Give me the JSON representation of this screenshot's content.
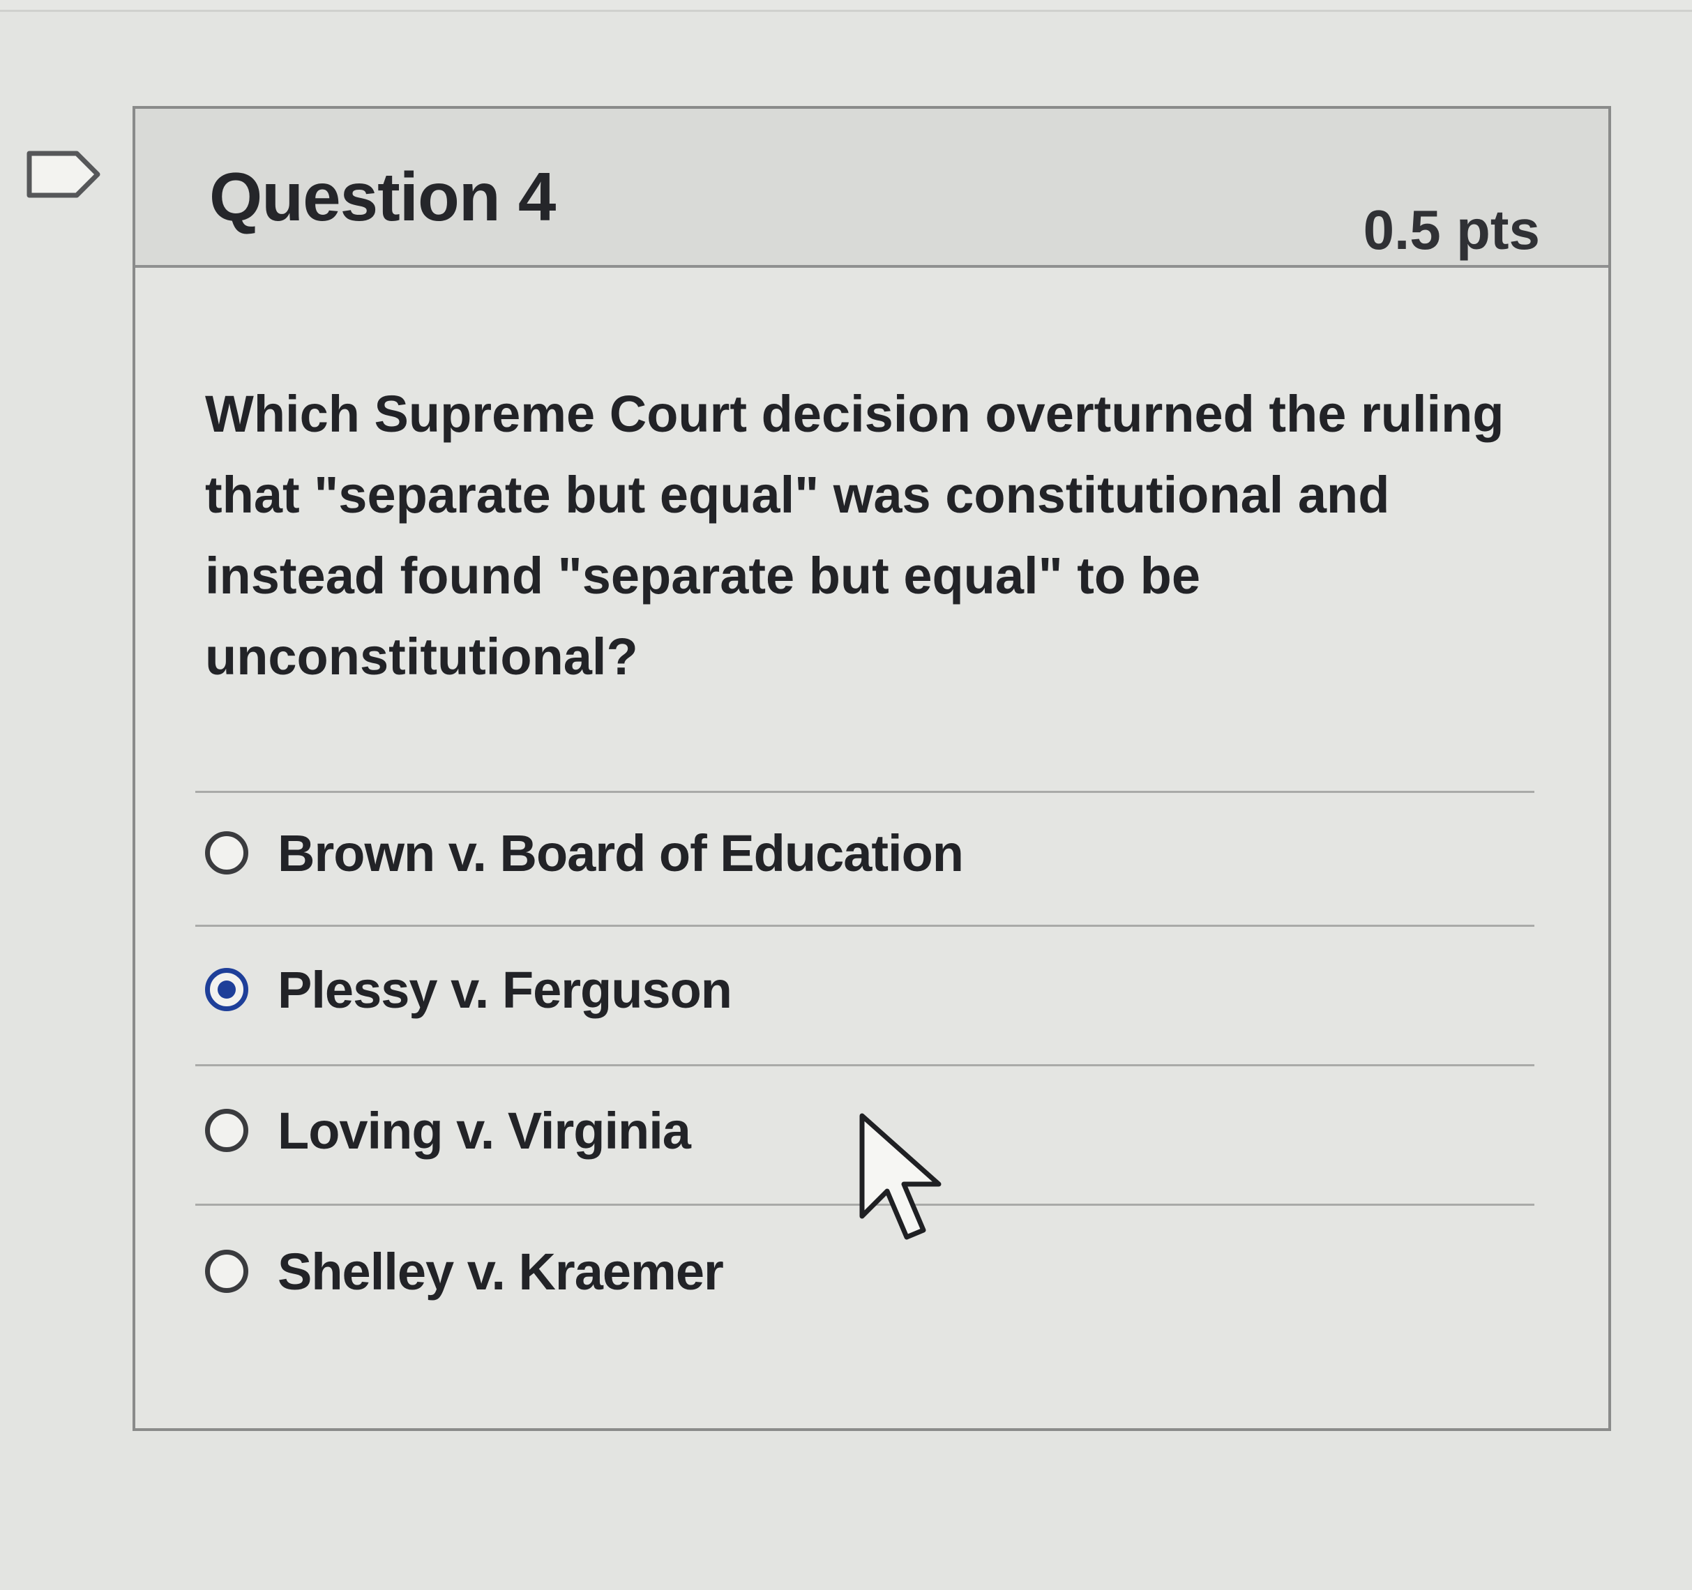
{
  "question": {
    "title": "Question 4",
    "points": "0.5 pts",
    "text": "Which Supreme Court decision overturned the ruling that \"separate but equal\" was constitutional and instead found \"separate but equal\" to be unconstitutional?"
  },
  "answers": [
    {
      "label": "Brown v. Board of Education",
      "selected": false
    },
    {
      "label": "Plessy v. Ferguson",
      "selected": true
    },
    {
      "label": "Loving v. Virginia",
      "selected": false
    },
    {
      "label": "Shelley v. Kraemer",
      "selected": false
    }
  ],
  "icons": {
    "flag": "flag-outline-icon",
    "cursor": "mouse-pointer-icon"
  },
  "colors": {
    "selected_radio": "#1e3f99",
    "header_background": "#d9dad7",
    "card_border": "#8a8b8a"
  }
}
